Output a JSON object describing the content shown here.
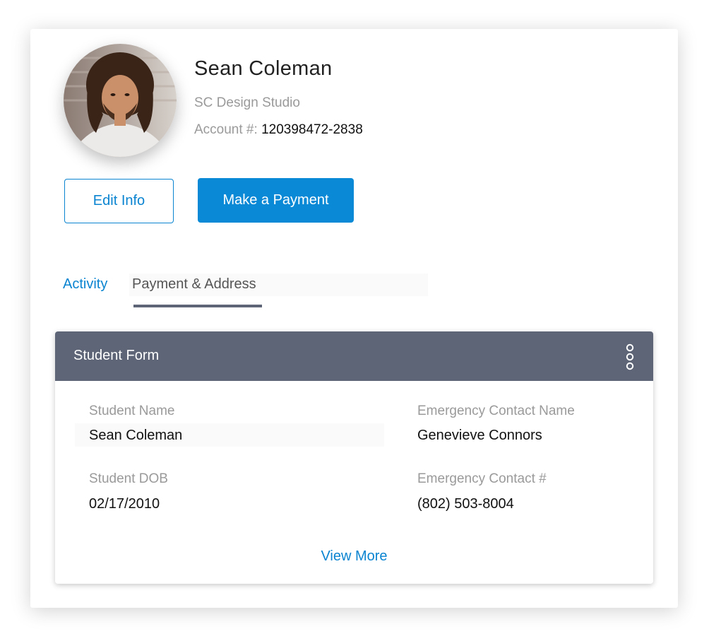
{
  "profile": {
    "name": "Sean Coleman",
    "company": "SC Design Studio",
    "account_label": "Account #:",
    "account_number": "120398472-2838"
  },
  "actions": {
    "edit_label": "Edit Info",
    "pay_label": "Make a Payment"
  },
  "tabs": [
    {
      "label": "Activity",
      "active": false
    },
    {
      "label": "Payment & Address",
      "active": true
    }
  ],
  "student_form": {
    "title": "Student Form",
    "fields": {
      "student_name": {
        "label": "Student Name",
        "value": "Sean Coleman"
      },
      "student_dob": {
        "label": "Student DOB",
        "value": "02/17/2010"
      },
      "emergency_name": {
        "label": "Emergency Contact Name",
        "value": "Genevieve Connors"
      },
      "emergency_phone": {
        "label": "Emergency Contact #",
        "value": "(802) 503-8004"
      }
    },
    "view_more_label": "View More"
  },
  "colors": {
    "accent": "#0a84d0",
    "button_fill": "#0a8ad6",
    "header": "#5d6576"
  },
  "icons": {
    "menu": "vertical-ellipsis-icon"
  }
}
